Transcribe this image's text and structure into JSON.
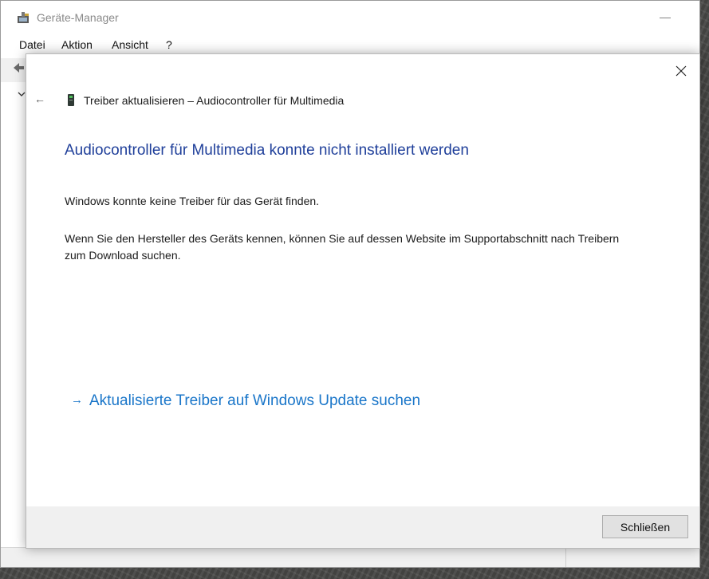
{
  "device_manager": {
    "title": "Geräte-Manager",
    "minimize_glyph": "—",
    "menu": [
      {
        "label": "Datei"
      },
      {
        "label": "Aktion"
      },
      {
        "label": "Ansicht"
      },
      {
        "label": "?"
      }
    ]
  },
  "dialog": {
    "header_title": "Treiber aktualisieren – Audiocontroller für Multimedia",
    "back_glyph": "←",
    "heading": "Audiocontroller für Multimedia konnte nicht installiert werden",
    "message1": "Windows konnte keine Treiber für das Gerät finden.",
    "message2": "Wenn Sie den Hersteller des Geräts kennen, können Sie auf dessen Website im Supportabschnitt nach Treibern zum Download suchen.",
    "link_arrow": "→",
    "link_label": "Aktualisierte Treiber auf Windows Update suchen",
    "close_button_label": "Schließen"
  },
  "colors": {
    "heading": "#1f3f9a",
    "link": "#1a76c9",
    "footer_bg": "#f0f0f0"
  }
}
